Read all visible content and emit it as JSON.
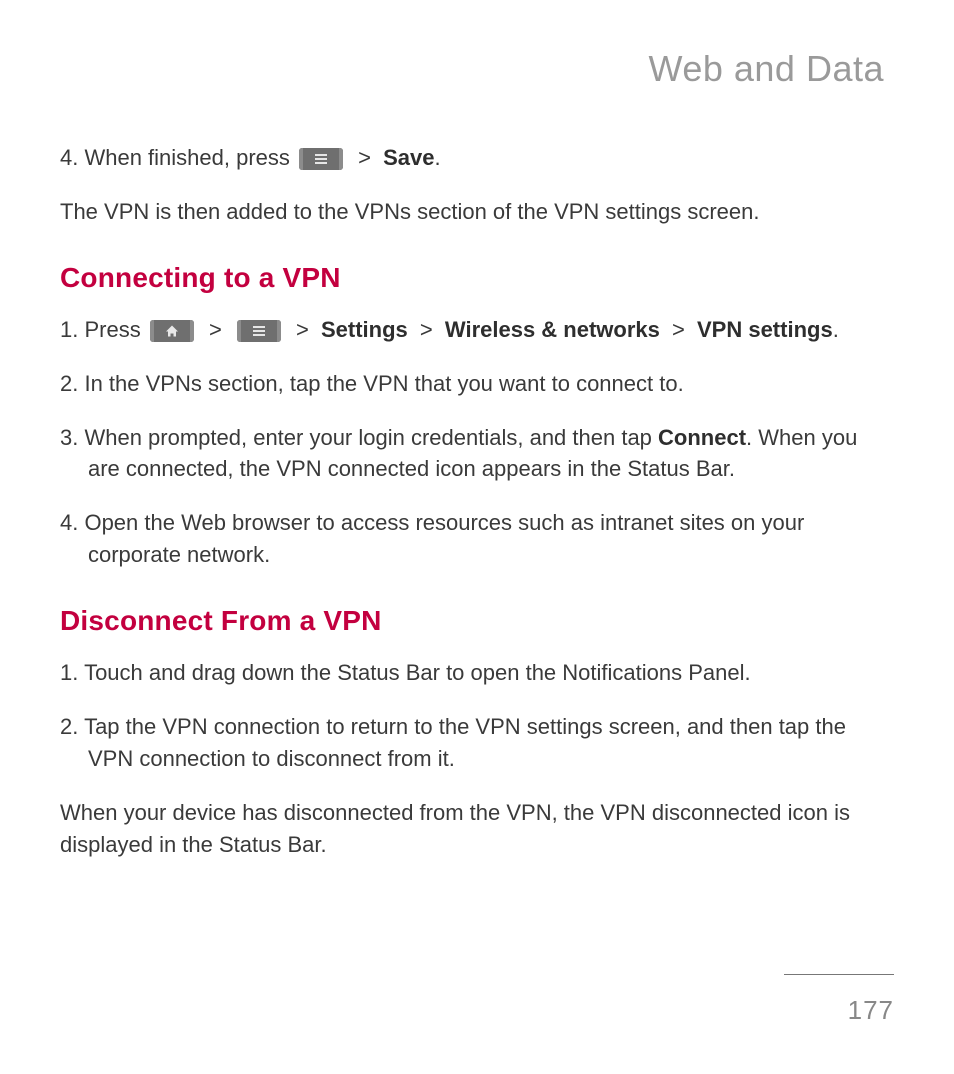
{
  "header": {
    "title": "Web and Data"
  },
  "intro": {
    "step4_prefix": "4. When finished, press ",
    "step4_sep": " > ",
    "step4_save": "Save",
    "step4_period": ".",
    "following": "The VPN is then added to the VPNs section of the VPN settings screen."
  },
  "section_connect": {
    "heading": "Connecting to a VPN",
    "step1_prefix": "1. Press ",
    "step1_sep1": " > ",
    "step1_sep2": " > ",
    "step1_settings": "Settings",
    "step1_sep3": " > ",
    "step1_wireless": "Wireless & networks",
    "step1_sep4": " > ",
    "step1_vpn": "VPN settings",
    "step1_period": ".",
    "step2": "2. In the VPNs section, tap the VPN that you want to connect to.",
    "step3_a": "3. When prompted, enter your login credentials, and then tap ",
    "step3_connect": "Connect",
    "step3_b": ". When you are connected, the VPN connected icon appears in the Status Bar.",
    "step4": "4. Open the Web browser to access resources such as intranet sites on your corporate network."
  },
  "section_disconnect": {
    "heading": "Disconnect From a VPN",
    "step1": "1. Touch and drag down the Status Bar to open the Notifications Panel.",
    "step2": "2. Tap the VPN connection to return to the VPN settings screen, and then tap the VPN connection to disconnect from it.",
    "following": "When your device has disconnected from the VPN, the VPN disconnected icon is displayed in the Status Bar."
  },
  "footer": {
    "page_number": "177"
  }
}
